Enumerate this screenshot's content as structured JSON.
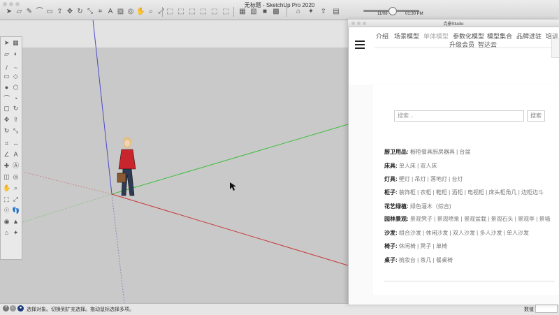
{
  "window": {
    "title": "无标题 - SketchUp Pro 2020"
  },
  "toolbar": {
    "icons": [
      "select-icon",
      "eraser-icon",
      "pencil-icon",
      "arc-icon",
      "rectangle-icon",
      "push-pull-icon",
      "move-icon",
      "rotate-icon",
      "scale-icon",
      "tape-icon",
      "text-icon",
      "paint-icon",
      "orbit-icon",
      "pan-icon",
      "zoom-icon",
      "zoom-extents-icon",
      "iso-view-icon",
      "top-view-icon",
      "front-view-icon",
      "right-view-icon",
      "back-view-icon",
      "left-view-icon",
      "wireframe-icon",
      "hidden-line-icon",
      "shaded-icon",
      "textured-icon",
      "warehouse-icon",
      "extension-icon",
      "share-icon",
      "layout-icon"
    ],
    "time_start": "11/08",
    "time_end": "01:30 PM"
  },
  "status": {
    "message": "选择对象。切换到扩充选择。拖动鼠标选择多项。",
    "measure_label": "数值"
  },
  "panel": {
    "title": "克豪Studio",
    "nav": [
      {
        "label": "介绍"
      },
      {
        "label": "场景模型"
      },
      {
        "label": "单体模型"
      },
      {
        "label": "参数化模型"
      },
      {
        "label": "模型集合"
      },
      {
        "label": "品牌进驻"
      },
      {
        "label": "培训"
      },
      {
        "label": "升级会员"
      },
      {
        "label": "智达云"
      }
    ],
    "search": {
      "placeholder": "搜索...",
      "button": "搜索"
    },
    "categories": [
      {
        "name": "厨卫用品:",
        "items": "橱柜餐具厨房器具 | 台盆"
      },
      {
        "name": "床具:",
        "items": "单人床 | 双人床"
      },
      {
        "name": "灯具:",
        "items": "壁灯 | 吊灯 | 落地灯 | 台灯"
      },
      {
        "name": "柜子:",
        "items": "装饰柜 | 衣柜 | 鞋柜 | 酒柜 | 电视柜 | 床头柜角几 | 边柜边斗"
      },
      {
        "name": "花艺绿植:",
        "items": "绿色灌木（综合)"
      },
      {
        "name": "园林景观:",
        "items": "景观凳子 | 景观喷泉 | 景观盆栽 | 景观石头 | 景观亭 | 景墙"
      },
      {
        "name": "沙发:",
        "items": "组合沙发 | 休闲沙发 | 双人沙发 | 多人沙发 | 单人沙发"
      },
      {
        "name": "椅子:",
        "items": "休闲椅 | 凳子 | 单椅"
      },
      {
        "name": "桌子:",
        "items": "梳妆台 | 茶几 | 餐桌椅"
      }
    ]
  },
  "colors": {
    "axis_blue": "#4a4ac8",
    "axis_green": "#3fbf3f",
    "axis_red": "#c83a3a",
    "figure_red": "#c8262c"
  }
}
